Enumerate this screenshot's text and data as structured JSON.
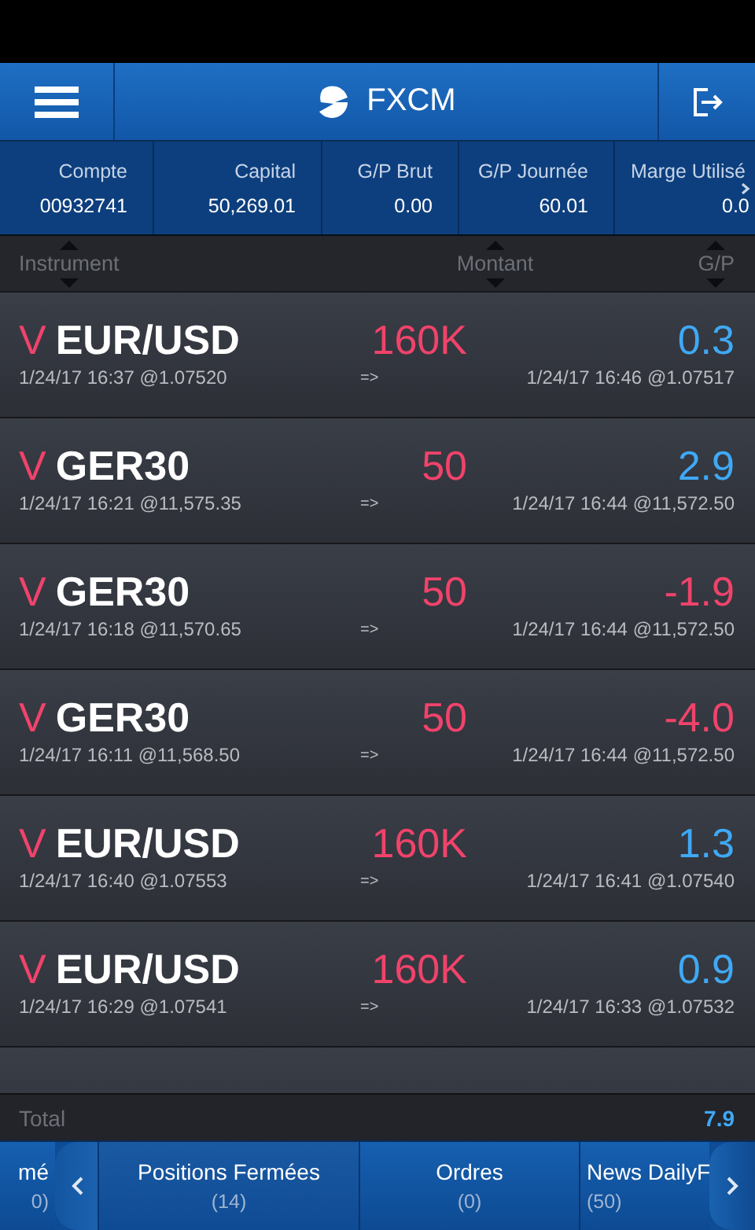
{
  "header": {
    "title": "FXCM"
  },
  "summary": [
    {
      "label": "Compte",
      "value": "00932741"
    },
    {
      "label": "Capital",
      "value": "50,269.01"
    },
    {
      "label": "G/P Brut",
      "value": "0.00"
    },
    {
      "label": "G/P Journée",
      "value": "60.01"
    },
    {
      "label": "Marge Utilisé",
      "value": "0.0"
    }
  ],
  "columns": [
    "Instrument",
    "Montant",
    "G/P"
  ],
  "rows": [
    {
      "kind": "sell",
      "direction": "V",
      "instrument": "EUR/USD",
      "amount": "160K",
      "pl": "0.3",
      "gain": true,
      "open": "1/24/17 16:37 @1.07520",
      "arrow": "=>",
      "close": "1/24/17 16:46 @1.07517"
    },
    {
      "kind": "sell",
      "direction": "V",
      "instrument": "GER30",
      "amount": "50",
      "pl": "2.9",
      "gain": true,
      "open": "1/24/17 16:21 @11,575.35",
      "arrow": "=>",
      "close": "1/24/17 16:44 @11,572.50"
    },
    {
      "kind": "sell",
      "direction": "V",
      "instrument": "GER30",
      "amount": "50",
      "pl": "-1.9",
      "gain": false,
      "open": "1/24/17 16:18 @11,570.65",
      "arrow": "=>",
      "close": "1/24/17 16:44 @11,572.50"
    },
    {
      "kind": "sell",
      "direction": "V",
      "instrument": "GER30",
      "amount": "50",
      "pl": "-4.0",
      "gain": false,
      "open": "1/24/17 16:11 @11,568.50",
      "arrow": "=>",
      "close": "1/24/17 16:44 @11,572.50"
    },
    {
      "kind": "sell",
      "direction": "V",
      "instrument": "EUR/USD",
      "amount": "160K",
      "pl": "1.3",
      "gain": true,
      "open": "1/24/17 16:40 @1.07553",
      "arrow": "=>",
      "close": "1/24/17 16:41 @1.07540"
    },
    {
      "kind": "sell",
      "direction": "V",
      "instrument": "EUR/USD",
      "amount": "160K",
      "pl": "0.9",
      "gain": true,
      "open": "1/24/17 16:29 @1.07541",
      "arrow": "=>",
      "close": "1/24/17 16:33 @1.07532"
    },
    {
      "kind": "partial"
    }
  ],
  "total": {
    "label": "Total",
    "value": "7.9"
  },
  "tabs": [
    {
      "label": "mé",
      "count": "0)",
      "selected": false
    },
    {
      "label": "Positions Fermées",
      "count": "(14)",
      "selected": true
    },
    {
      "label": "Ordres",
      "count": "(0)",
      "selected": false
    },
    {
      "label": "News DailyF",
      "count": "(50)",
      "selected": false
    }
  ]
}
